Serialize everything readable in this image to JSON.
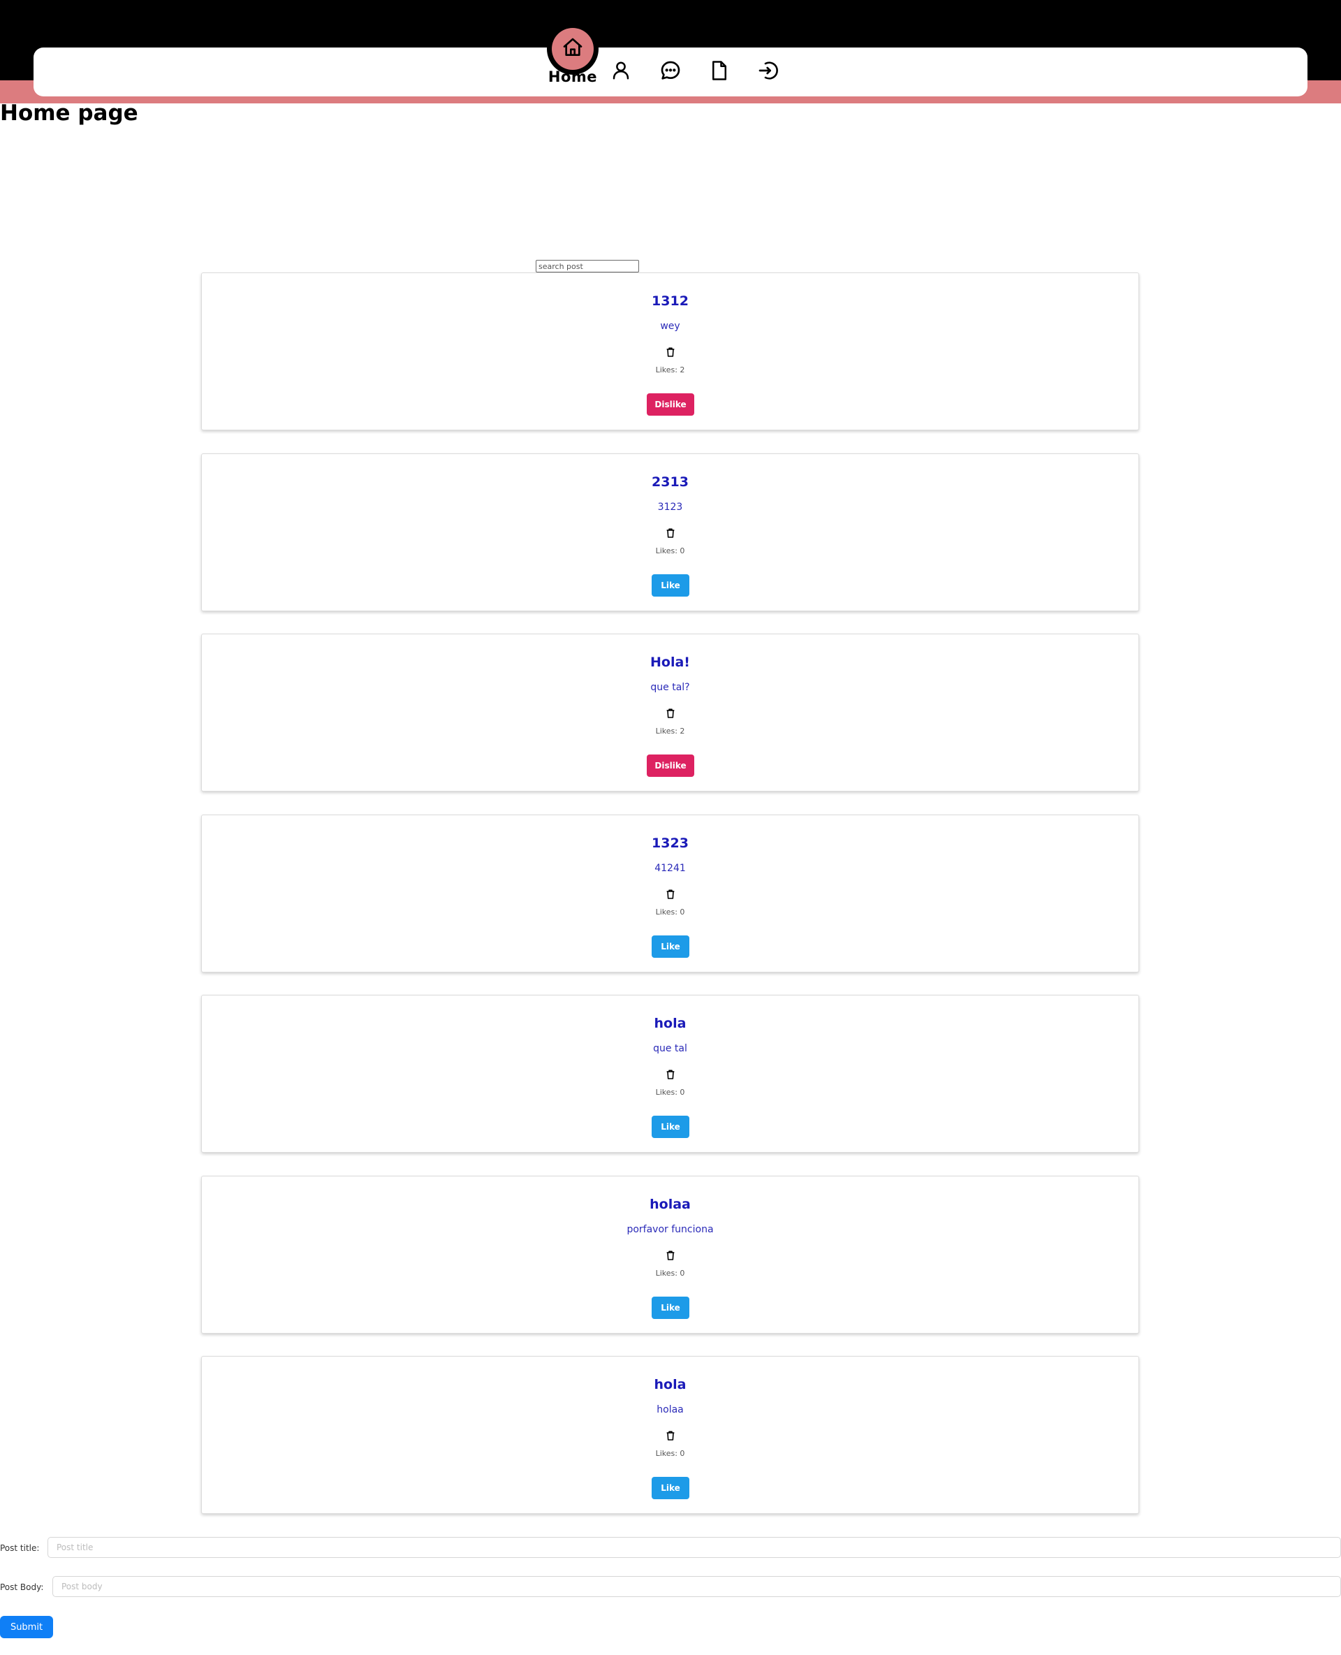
{
  "nav": {
    "active_label": "Home",
    "items": [
      {
        "icon": "home-icon",
        "label": "Home"
      },
      {
        "icon": "user-icon"
      },
      {
        "icon": "chat-icon"
      },
      {
        "icon": "document-icon"
      },
      {
        "icon": "logout-icon"
      }
    ],
    "colors": {
      "header_bg": "#000000",
      "accent": "#dc7c7f"
    }
  },
  "page": {
    "title": "Home page"
  },
  "search": {
    "placeholder": "search post"
  },
  "posts": [
    {
      "title": "1312",
      "body": "wey",
      "likes_text": "Likes: 2",
      "likes": 2,
      "action": "Dislike"
    },
    {
      "title": "2313",
      "body": "3123",
      "likes_text": "Likes: 0",
      "likes": 0,
      "action": "Like"
    },
    {
      "title": "Hola!",
      "body": "que tal?",
      "likes_text": "Likes: 2",
      "likes": 2,
      "action": "Dislike"
    },
    {
      "title": "1323",
      "body": "41241",
      "likes_text": "Likes: 0",
      "likes": 0,
      "action": "Like"
    },
    {
      "title": "hola",
      "body": "que tal",
      "likes_text": "Likes: 0",
      "likes": 0,
      "action": "Like"
    },
    {
      "title": "holaa",
      "body": "porfavor funciona",
      "likes_text": "Likes: 0",
      "likes": 0,
      "action": "Like"
    },
    {
      "title": "hola",
      "body": "holaa",
      "likes_text": "Likes: 0",
      "likes": 0,
      "action": "Like"
    }
  ],
  "form": {
    "title_label": "Post title:",
    "title_placeholder": "Post title",
    "title_value": "",
    "body_label": "Post Body:",
    "body_placeholder": "Post body",
    "body_value": "",
    "submit_label": "Submit"
  },
  "colors": {
    "like_button": "#1d9be8",
    "dislike_button": "#dd2261",
    "submit_button": "#0f7ff6",
    "post_title": "#1a1ab8"
  }
}
